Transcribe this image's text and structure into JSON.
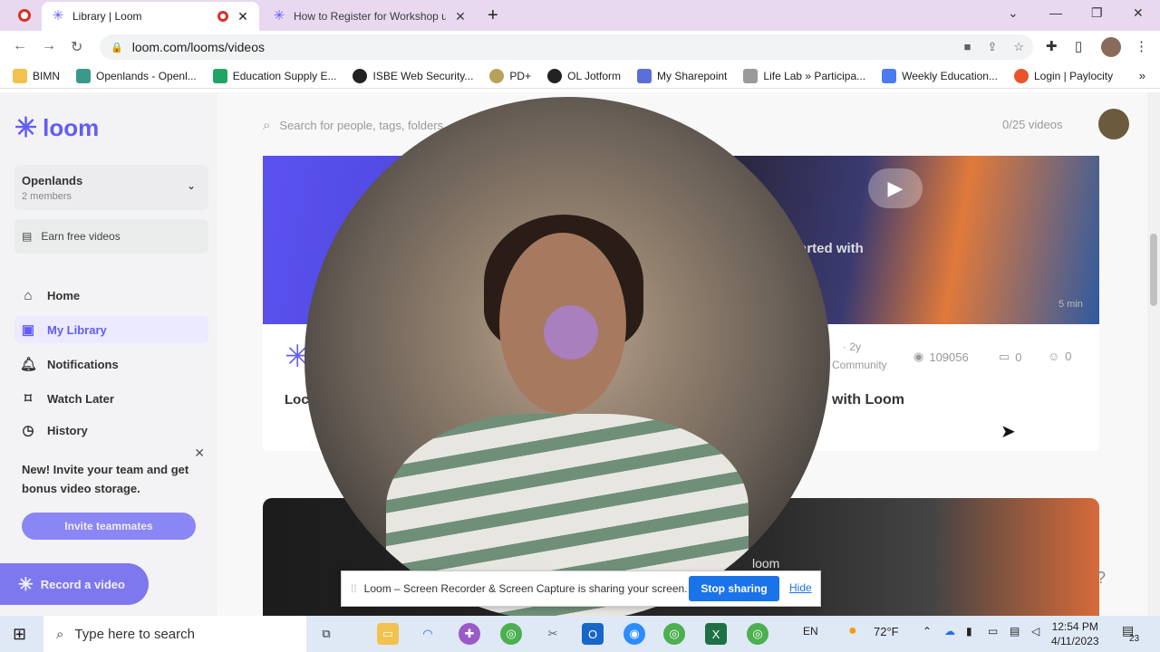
{
  "browser": {
    "tabs": [
      {
        "title": "Library | Loom",
        "active": true
      },
      {
        "title": "How to Register for Workshop us",
        "active": false
      }
    ],
    "url": "loom.com/looms/videos",
    "bookmarks": [
      "BIMN",
      "Openlands - Openl...",
      "Education Supply E...",
      "ISBE Web Security...",
      "PD+",
      "OL Jotform",
      "My Sharepoint",
      "Life Lab » Participa...",
      "Weekly Education...",
      "Login | Paylocity"
    ]
  },
  "sidebar": {
    "logo": "loom",
    "workspace": {
      "name": "Openlands",
      "members": "2 members"
    },
    "earn": "Earn free videos",
    "nav": [
      {
        "label": "Home",
        "icon": "home-icon"
      },
      {
        "label": "My Library",
        "icon": "library-icon"
      },
      {
        "label": "Notifications",
        "icon": "bell-icon"
      },
      {
        "label": "Watch Later",
        "icon": "bookmark-icon"
      },
      {
        "label": "History",
        "icon": "history-icon"
      }
    ],
    "invite": {
      "text": "New! Invite your team and get bonus video storage.",
      "button": "Invite teammates"
    },
    "record": "Record a video"
  },
  "main": {
    "search_placeholder": "Search for people, tags, folders...",
    "video_count": "0/25 videos",
    "video1": {
      "thumb_text": "arted with",
      "duration": "5 min",
      "title_left": "Loc",
      "title_right": "with Loom",
      "meta_age": "· 2y",
      "meta_space": "Community",
      "views": "109056",
      "comments": "0",
      "reactions": "0"
    },
    "video2": {
      "logo": "loom"
    }
  },
  "sharebar": {
    "text": "Loom – Screen Recorder & Screen Capture is sharing your screen.",
    "stop": "Stop sharing",
    "hide": "Hide"
  },
  "taskbar": {
    "search": "Type here to search",
    "lang": "EN",
    "weather": "72°F",
    "time": "12:54 PM",
    "date": "4/11/2023",
    "notif_count": "23"
  },
  "colors": {
    "accent": "#625df5",
    "tab_strip": "#e8d8f0",
    "stop_button": "#1a73e8"
  }
}
